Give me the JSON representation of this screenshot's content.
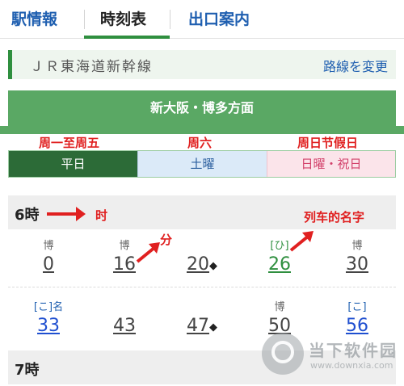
{
  "tabs": [
    {
      "label": "駅情報"
    },
    {
      "label": "時刻表"
    },
    {
      "label": "出口案内"
    }
  ],
  "line": {
    "name": "ＪＲ東海道新幹線",
    "change_label": "路線を変更"
  },
  "direction": "新大阪・博多方面",
  "day_tabs": [
    {
      "label": "平日",
      "annotation": "周一至周五"
    },
    {
      "label": "土曜",
      "annotation": "周六"
    },
    {
      "label": "日曜・祝日",
      "annotation": "周日节假日"
    }
  ],
  "annotations": {
    "hour": "时",
    "minute": "分",
    "train_name": "列车的名字"
  },
  "hours": [
    {
      "label": "6時",
      "rows": [
        [
          {
            "tag": "博",
            "minute": "0"
          },
          {
            "tag": "博",
            "minute": "16"
          },
          {
            "tag": "",
            "minute": "20",
            "mark": "◆"
          },
          {
            "tag": "[ひ]",
            "minute": "26",
            "style": "green"
          },
          {
            "tag": "博",
            "minute": "30"
          }
        ],
        [
          {
            "tag": "[こ]名",
            "minute": "33",
            "style": "blue"
          },
          {
            "tag": "",
            "minute": "43"
          },
          {
            "tag": "",
            "minute": "47",
            "mark": "◆"
          },
          {
            "tag": "博",
            "minute": "50"
          },
          {
            "tag": "[こ]",
            "minute": "56",
            "style": "blue"
          }
        ]
      ]
    },
    {
      "label": "7時"
    }
  ],
  "watermark": {
    "brand": "当下软件园",
    "url": "www.downxia.com"
  },
  "colors": {
    "accent_green": "#2f8f3f",
    "link_blue": "#1f5fb0",
    "annotation_red": "#e02020"
  }
}
